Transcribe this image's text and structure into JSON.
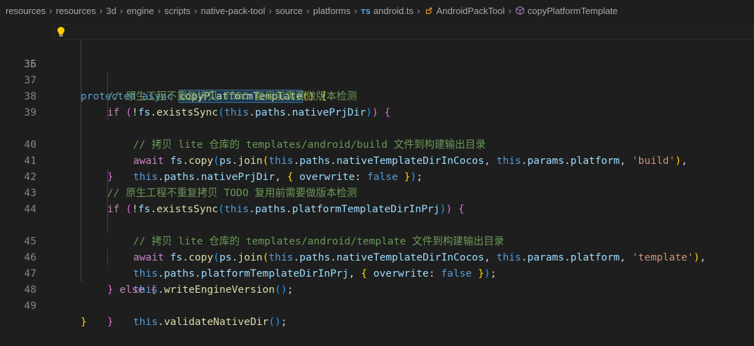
{
  "breadcrumb": {
    "items": [
      "resources",
      "resources",
      "3d",
      "engine",
      "scripts",
      "native-pack-tool",
      "source",
      "platforms"
    ],
    "file_badge": "TS",
    "file": "android.ts",
    "class": "AndroidPackTool",
    "method": "copyPlatformTemplate"
  },
  "lines": [
    {
      "num": "35"
    },
    {
      "num": "36"
    },
    {
      "num": "37"
    },
    {
      "num": "38"
    },
    {
      "num": "39"
    },
    {
      "num": ""
    },
    {
      "num": "40"
    },
    {
      "num": "41"
    },
    {
      "num": "42"
    },
    {
      "num": "43"
    },
    {
      "num": "44"
    },
    {
      "num": ""
    },
    {
      "num": "45"
    },
    {
      "num": "46"
    },
    {
      "num": "47"
    },
    {
      "num": "48"
    },
    {
      "num": "49"
    }
  ],
  "code": {
    "l35": {
      "kw1": "protected",
      "kw2": "async",
      "fn": "copyPlatformTemplate",
      "p1": "()",
      "p2": "{"
    },
    "l36": {
      "comment": "// 原生工程不重复拷贝 TODO 复用前需要做版本检测"
    },
    "l37": {
      "kw": "if",
      "p1": "(",
      "not": "!",
      "obj": "fs",
      "fn": "existsSync",
      "p2": "(",
      "this": "this",
      "v1": "paths",
      "v2": "nativePrjDir",
      "p3": ")",
      "p4": ")",
      "p5": "{"
    },
    "l38": {
      "comment": "// 拷贝 lite 仓库的 templates/android/build 文件到构建输出目录"
    },
    "l39": {
      "kw": "await",
      "obj": "fs",
      "fn": "copy",
      "p1": "(",
      "obj2": "ps",
      "fn2": "join",
      "p2": "(",
      "this1": "this",
      "v1": "paths",
      "v2": "nativeTemplateDirInCocos",
      "this2": "this",
      "v3": "params",
      "v4": "platform",
      "str": "'build'",
      "p3": ")"
    },
    "l39b": {
      "this": "this",
      "v1": "paths",
      "v2": "nativePrjDir",
      "p1": "{",
      "v3": "overwrite",
      "kw": "false",
      "p2": "}",
      "p3": ")"
    },
    "l40": {
      "p": "}"
    },
    "l41": {
      "comment": "// 原生工程不重复拷贝 TODO 复用前需要做版本检测"
    },
    "l42": {
      "kw": "if",
      "p1": "(",
      "not": "!",
      "obj": "fs",
      "fn": "existsSync",
      "p2": "(",
      "this": "this",
      "v1": "paths",
      "v2": "platformTemplateDirInPrj",
      "p3": ")",
      "p4": ")",
      "p5": "{"
    },
    "l43": {
      "comment": "// 拷贝 lite 仓库的 templates/android/template 文件到构建输出目录"
    },
    "l44": {
      "kw": "await",
      "obj": "fs",
      "fn": "copy",
      "p1": "(",
      "obj2": "ps",
      "fn2": "join",
      "p2": "(",
      "this1": "this",
      "v1": "paths",
      "v2": "nativeTemplateDirInCocos",
      "this2": "this",
      "v3": "params",
      "v4": "platform",
      "str": "'template'",
      "p3": ")"
    },
    "l44b": {
      "this": "this",
      "v1": "paths",
      "v2": "platformTemplateDirInPrj",
      "p1": "{",
      "v3": "overwrite",
      "kw": "false",
      "p2": "}",
      "p3": ")"
    },
    "l45": {
      "this": "this",
      "fn": "writeEngineVersion",
      "p": "()"
    },
    "l46": {
      "p1": "}",
      "kw": "else",
      "p2": "{"
    },
    "l47": {
      "this": "this",
      "fn": "validateNativeDir",
      "p": "()"
    },
    "l48": {
      "p": "}"
    },
    "l49": {
      "p": "}"
    }
  },
  "colors": {
    "background": "#1e1e1e",
    "keyword": "#569cd6",
    "control": "#c586c0",
    "function": "#dcdcaa",
    "variable": "#9cdcfe",
    "object": "#4ec9b0",
    "string": "#ce9178",
    "comment": "#6a9955"
  }
}
